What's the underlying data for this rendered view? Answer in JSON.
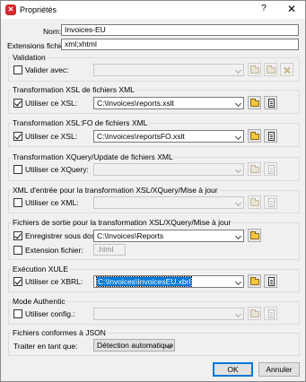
{
  "window": {
    "title": "Propriétés",
    "help": "?",
    "close": "✕",
    "app_icon": "altova-icon"
  },
  "general": {
    "name_label": "Nom:",
    "name_value": "Invoices-EU",
    "ext_label": "Extensions fichier:",
    "ext_value": "xml;xhtml"
  },
  "validation": {
    "title": "Validation",
    "checkbox_label": "Valider avec:",
    "checked": false,
    "value": ""
  },
  "xsl": {
    "title": "Transformation XSL de fichiers XML",
    "checkbox_label": "Utiliser ce XSL:",
    "checked": true,
    "value": "C:\\Invoices\\reports.xslt"
  },
  "xslfo": {
    "title": "Transformation XSL:FO de fichiers XML",
    "checkbox_label": "Utiliser ce XSL:",
    "checked": true,
    "value": "C:\\Invoices\\reportsFO.xslt"
  },
  "xquery": {
    "title": "Transformation XQuery/Update de fichiers XML",
    "checkbox_label": "Utiliser ce XQuery:",
    "checked": false,
    "value": ""
  },
  "xml_input": {
    "title": "XML d'entrée pour la transformation XSL/XQuery/Mise à jour",
    "checkbox_label": "Utiliser ce XML:",
    "checked": false,
    "value": ""
  },
  "output": {
    "title": "Fichiers de sortie pour la transformation XSL/XQuery/Mise à jour",
    "save_label": "Enregistrer sous dossier:",
    "save_checked": true,
    "save_value": "C:\\Invoices\\Reports",
    "ext_label": "Extension fichier:",
    "ext_checked": false,
    "ext_value": ".html"
  },
  "xule": {
    "title": "Exécution XULE",
    "checkbox_label": "Utiliser ce XBRL:",
    "checked": true,
    "value": "C:\\Invoices\\InvoicesEU.xbrl"
  },
  "authentic": {
    "title": "Mode Authentic",
    "checkbox_label": "Utiliser config.:",
    "checked": false,
    "value": ""
  },
  "json": {
    "title": "Fichiers conformes à JSON",
    "treat_label": "Traiter en tant que:",
    "treat_value": "Détection automatique"
  },
  "buttons": {
    "ok": "OK",
    "cancel": "Annuler"
  }
}
